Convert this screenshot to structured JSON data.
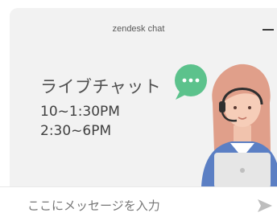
{
  "header": {
    "title": "zendesk chat",
    "minimize_icon": "minimize-icon"
  },
  "banner": {
    "title": "ライブチャット",
    "hours": [
      "10~1:30PM",
      "2:30~6PM"
    ],
    "chat_badge_icon": "chat-bubble-icon",
    "agent_image": "support-agent-illustration"
  },
  "composer": {
    "placeholder": "ここにメッセージを入力",
    "send_icon": "send-icon"
  },
  "colors": {
    "panel_bg": "#f2f2f2",
    "badge_green": "#5cc28c",
    "agent_hair": "#e09f8a",
    "agent_shirt": "#5b7fc4",
    "send_arrow": "#bdbdbd"
  }
}
